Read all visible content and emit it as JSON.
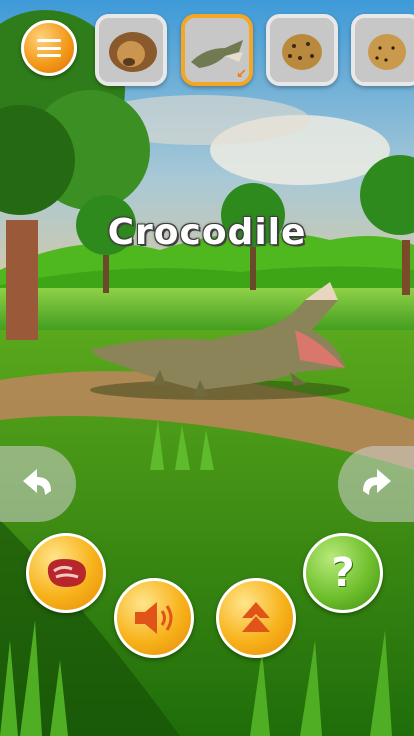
{
  "game": {
    "animal_title": "Crocodile"
  },
  "animal_bar": [
    {
      "name": "lion-thumb",
      "icon": "lion",
      "selected": false
    },
    {
      "name": "crocodile-thumb",
      "icon": "crocodile",
      "selected": true
    },
    {
      "name": "leopard-thumb",
      "icon": "leopard",
      "selected": false
    },
    {
      "name": "cheetah-thumb",
      "icon": "cheetah",
      "selected": false
    }
  ],
  "controls": {
    "menu_icon": "hamburger-icon",
    "rotate_left_icon": "rotate-left-icon",
    "rotate_right_icon": "rotate-right-icon",
    "feed_icon": "meat-icon",
    "sound_icon": "speaker-icon",
    "action_icon": "double-up-arrow-icon",
    "help_label": "?"
  },
  "colors": {
    "button_orange": "#f7b21a",
    "button_green": "#6fbf2d",
    "selected_border": "#f5a623",
    "title_text": "#ffffff"
  }
}
